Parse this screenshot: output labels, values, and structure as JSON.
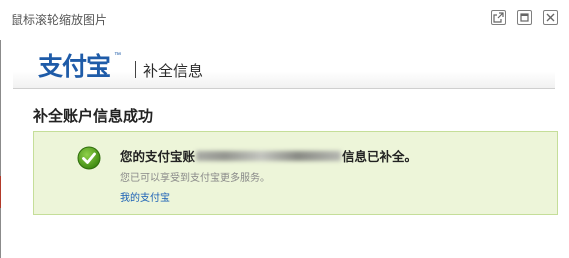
{
  "window": {
    "title": "鼠标滚轮缩放图片",
    "buttons": [
      {
        "name": "popout",
        "icon": "external-link-icon"
      },
      {
        "name": "maximize",
        "icon": "maximize-icon"
      },
      {
        "name": "close",
        "icon": "close-icon"
      }
    ]
  },
  "header": {
    "logo_text": "支付宝",
    "logo_trademark": "™",
    "page_title": "补全信息"
  },
  "main": {
    "section_title": "补全账户信息成功",
    "success": {
      "title_prefix": "您的支付宝账",
      "title_suffix": "信息已补全。",
      "description": "您已可以享受到支付宝更多服务。",
      "link_label": "我的支付宝"
    }
  },
  "colors": {
    "brand_blue": "#1e5ba8",
    "success_bg": "#edf5d9",
    "success_border": "#c5de99",
    "link": "#1a60b6",
    "check_green": "#4e9a19"
  }
}
